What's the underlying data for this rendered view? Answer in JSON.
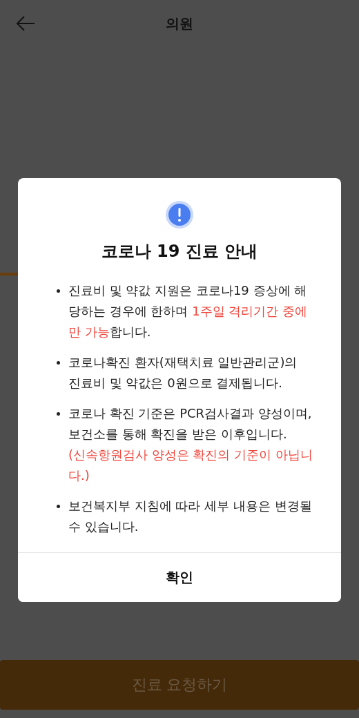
{
  "header": {
    "title": "의원"
  },
  "dialog": {
    "title": "코로나 19 진료 안내",
    "items": [
      {
        "segments": [
          {
            "kind": "normal",
            "text": "진료비 및 약값 지원은 코로나19 증상에 해당하는 경우에 한하며 "
          },
          {
            "kind": "highlight",
            "text": "1주일 격리기간 중에만 가능"
          },
          {
            "kind": "normal",
            "text": "합니다."
          }
        ]
      },
      {
        "segments": [
          {
            "kind": "normal",
            "text": "코로나확진 환자(재택치료 일반관리군)의 진료비 및 약값은 0원으로 결제됩니다."
          }
        ]
      },
      {
        "segments": [
          {
            "kind": "normal",
            "text": "코로나 확진 기준은 PCR검사결과 양성이며, 보건소를 통해 확진을 받은 이후입니다."
          }
        ],
        "note": "(신속항원검사 양성은 확진의 기준이 아닙니다.)"
      },
      {
        "segments": [
          {
            "kind": "normal",
            "text": "보건복지부 지침에 따라 세부 내용은 변경될 수 있습니다."
          }
        ]
      }
    ],
    "confirm": "확인"
  },
  "footer": {
    "button": "진료 요청하기"
  }
}
